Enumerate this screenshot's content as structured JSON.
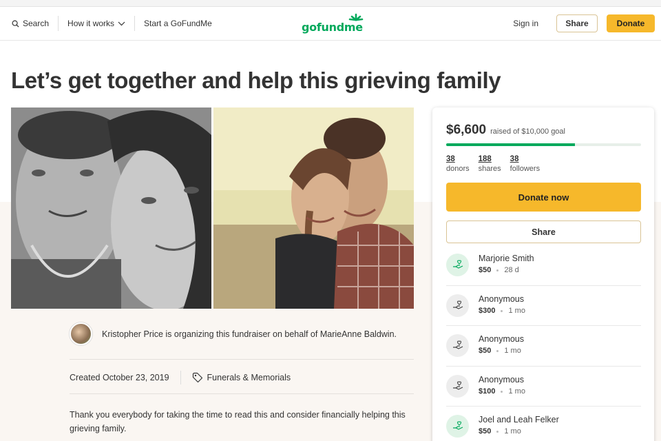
{
  "header": {
    "search_label": "Search",
    "how_it_works_label": "How it works",
    "start_label": "Start a GoFundMe",
    "logo_text": "gofundme",
    "signin_label": "Sign in",
    "share_label": "Share",
    "donate_label": "Donate"
  },
  "campaign": {
    "title": "Let’s get together and help this grieving family",
    "organizer_text": "Kristopher Price is organizing this fundraiser on behalf of MarieAnne Baldwin.",
    "created": "Created October 23, 2019",
    "category": "Funerals & Memorials",
    "story": "Thank you everybody for taking the time to read this and consider financially helping this grieving family."
  },
  "sidebar": {
    "raised_amount": "$6,600",
    "raised_goal": "raised of $10,000 goal",
    "progress_fraction": 0.66,
    "stats": [
      {
        "num": "38",
        "label": "donors"
      },
      {
        "num": "188",
        "label": "shares"
      },
      {
        "num": "38",
        "label": "followers"
      }
    ],
    "donate_now_label": "Donate now",
    "share_label": "Share",
    "donations": [
      {
        "name": "Marjorie Smith",
        "amount": "$50",
        "time": "28 d",
        "style": "green"
      },
      {
        "name": "Anonymous",
        "amount": "$300",
        "time": "1 mo",
        "style": "grey"
      },
      {
        "name": "Anonymous",
        "amount": "$50",
        "time": "1 mo",
        "style": "grey"
      },
      {
        "name": "Anonymous",
        "amount": "$100",
        "time": "1 mo",
        "style": "grey"
      },
      {
        "name": "Joel and Leah Felker",
        "amount": "$50",
        "time": "1 mo",
        "style": "green"
      }
    ]
  },
  "colors": {
    "brand_green": "#02a95c",
    "donate_yellow": "#f6b82b"
  }
}
